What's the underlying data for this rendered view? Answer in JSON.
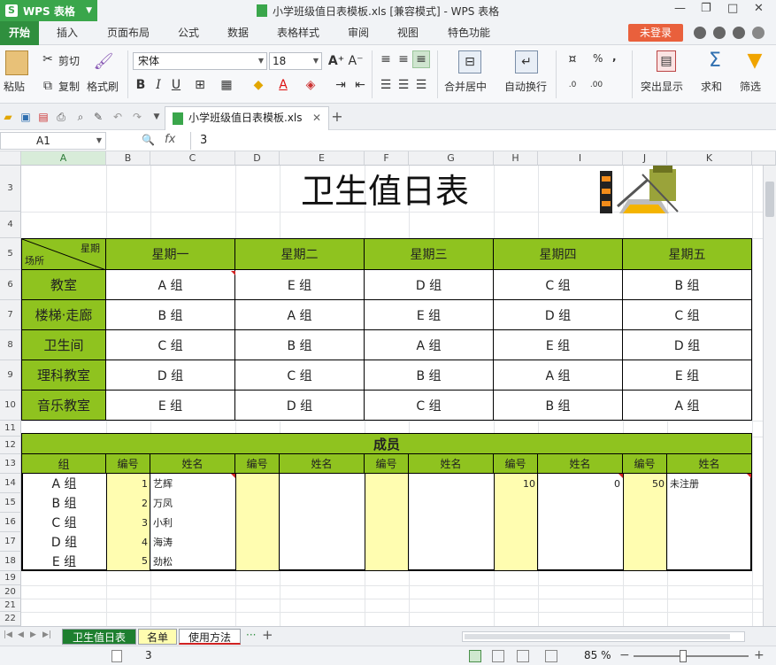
{
  "app": {
    "name": "WPS 表格",
    "window_title": "小学班级值日表模板.xls [兼容模式] - WPS 表格",
    "login": "未登录"
  },
  "menu": [
    "开始",
    "插入",
    "页面布局",
    "公式",
    "数据",
    "表格样式",
    "审阅",
    "视图",
    "特色功能"
  ],
  "toolbar": {
    "paste": "粘贴",
    "cut": "剪切",
    "copy": "复制",
    "format_painter": "格式刷",
    "font": "宋体",
    "size": "18",
    "merge_center": "合并居中",
    "wrap": "自动换行",
    "percent": "%",
    "comma": ",",
    "highlight": "突出显示",
    "sum": "求和",
    "filter": "筛选"
  },
  "doc_tab": "小学班级值日表模板.xls",
  "formula": {
    "cell_ref": "A1",
    "value": "3"
  },
  "columns": [
    "A",
    "B",
    "C",
    "D",
    "E",
    "F",
    "G",
    "H",
    "I",
    "J",
    "K"
  ],
  "rows": [
    "3",
    "4",
    "5",
    "6",
    "7",
    "8",
    "9",
    "10",
    "11",
    "12",
    "13",
    "14",
    "15",
    "16",
    "17",
    "18",
    "19",
    "20",
    "21",
    "22"
  ],
  "sheet": {
    "title": "卫生值日表",
    "corner_top": "星期",
    "corner_bottom": "场所",
    "days": [
      "星期一",
      "星期二",
      "星期三",
      "星期四",
      "星期五"
    ],
    "places": [
      {
        "name": "教室",
        "groups": [
          "A 组",
          "E 组",
          "D 组",
          "C 组",
          "B 组"
        ]
      },
      {
        "name": "楼梯·走廊",
        "groups": [
          "B 组",
          "A 组",
          "E 组",
          "D 组",
          "C 组"
        ]
      },
      {
        "name": "卫生间",
        "groups": [
          "C 组",
          "B 组",
          "A 组",
          "E 组",
          "D 组"
        ]
      },
      {
        "name": "理科教室",
        "groups": [
          "D 组",
          "C 组",
          "B 组",
          "A 组",
          "E 组"
        ]
      },
      {
        "name": "音乐教室",
        "groups": [
          "E 组",
          "D 组",
          "C 组",
          "B 组",
          "A 组"
        ]
      }
    ],
    "members_title": "成员",
    "member_header": [
      "组",
      "编号",
      "姓名",
      "编号",
      "姓名",
      "编号",
      "姓名",
      "编号",
      "姓名",
      "编号",
      "姓名"
    ],
    "member_rows": [
      [
        "A 组",
        "1",
        "艺辉",
        "",
        "",
        "",
        "",
        "10",
        "0",
        "50",
        "未注册"
      ],
      [
        "B 组",
        "2",
        "万凤",
        "",
        "",
        "",
        "",
        "",
        "",
        "",
        ""
      ],
      [
        "C 组",
        "3",
        "小利",
        "",
        "",
        "",
        "",
        "",
        "",
        "",
        ""
      ],
      [
        "D 组",
        "4",
        "海涛",
        "",
        "",
        "",
        "",
        "",
        "",
        "",
        ""
      ],
      [
        "E 组",
        "5",
        "劲松",
        "",
        "",
        "",
        "",
        "",
        "",
        "",
        ""
      ]
    ]
  },
  "sheet_tabs": [
    "卫生值日表",
    "名单",
    "使用方法"
  ],
  "status": {
    "page_value": "3",
    "zoom": "85 %"
  }
}
